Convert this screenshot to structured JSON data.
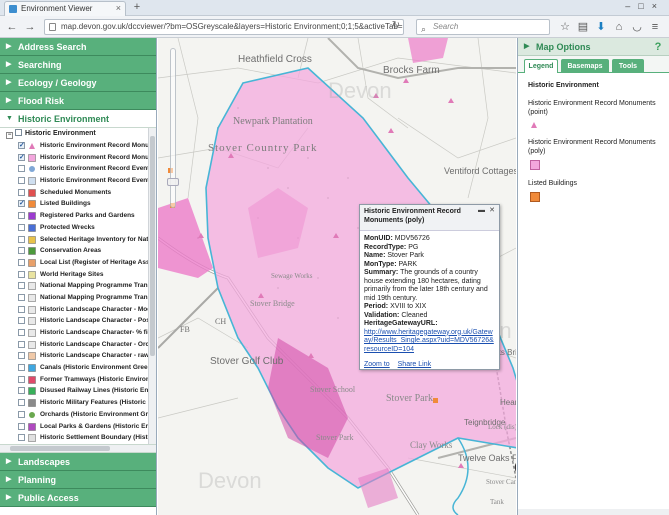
{
  "browser": {
    "tab_title": "Environment Viewer",
    "url": "map.devon.gov.uk/dccviewer/?bm=OSGreyscale&layers=Historic Environment;0;1;5&activeTab=Historic Environment&extent=...",
    "search_placeholder": "Search"
  },
  "left_panel": {
    "sections_top": [
      {
        "label": "Address Search"
      },
      {
        "label": "Searching"
      },
      {
        "label": "Ecology / Geology"
      },
      {
        "label": "Flood Risk"
      }
    ],
    "open_section": "Historic Environment",
    "tree_root": "Historic Environment",
    "layers": [
      {
        "label": "Historic Environment Record Monume",
        "checked": true,
        "symbol": "triangle",
        "color": "#e07ab8"
      },
      {
        "label": "Historic Environment Record Monume",
        "checked": true,
        "symbol": "square",
        "color": "#f3a6dd"
      },
      {
        "label": "Historic Environment Record Events (p",
        "checked": false,
        "symbol": "circle",
        "color": "#7fa7d6"
      },
      {
        "label": "Historic Environment Record Events (p",
        "checked": false,
        "symbol": "square",
        "color": "#cfdff0"
      },
      {
        "label": "Scheduled Monuments",
        "checked": false,
        "symbol": "square",
        "color": "#e05050"
      },
      {
        "label": "Listed Buildings",
        "checked": true,
        "symbol": "square",
        "color": "#f08a3a"
      },
      {
        "label": "Registered Parks and Gardens",
        "checked": false,
        "symbol": "square",
        "color": "#9c3bd0"
      },
      {
        "label": "Protected Wrecks",
        "checked": false,
        "symbol": "square",
        "color": "#4a6fd6"
      },
      {
        "label": "Selected Heritage Inventory for Natura",
        "checked": false,
        "symbol": "square",
        "color": "#e8c24a"
      },
      {
        "label": "Conservation Areas",
        "checked": false,
        "symbol": "square",
        "color": "#4c9a3c"
      },
      {
        "label": "Local List (Register of Heritage Assets",
        "checked": false,
        "symbol": "square",
        "color": "#e8a06a"
      },
      {
        "label": "World Heritage Sites",
        "checked": false,
        "symbol": "square",
        "color": "#e9e3a0"
      },
      {
        "label": "National Mapping Programme Transcrip",
        "checked": false,
        "symbol": "square",
        "color": "#e9e9e9"
      },
      {
        "label": "National Mapping Programme Transcrip",
        "checked": false,
        "symbol": "square",
        "color": "#e9e9e9"
      },
      {
        "label": "Historic Landscape Character - Modern",
        "checked": false,
        "symbol": "square",
        "color": "#e9e9e9"
      },
      {
        "label": "Historic Landscape Character - Postme",
        "checked": false,
        "symbol": "square",
        "color": "#e9e9e9"
      },
      {
        "label": "Historic Landscape Character- % field b",
        "checked": false,
        "symbol": "square",
        "color": "#e9e9e9"
      },
      {
        "label": "Historic Landscape Character - Orcharc",
        "checked": false,
        "symbol": "square",
        "color": "#e9e9e9"
      },
      {
        "label": "Historic Landscape Character - raw da",
        "checked": false,
        "symbol": "square",
        "color": "#f0c9a8"
      },
      {
        "label": "Canals (Historic Environment Green In",
        "checked": false,
        "symbol": "square",
        "color": "#3fa7e0"
      },
      {
        "label": "Former Tramways (Historic Environme",
        "checked": false,
        "symbol": "square",
        "color": "#e04a6a"
      },
      {
        "label": "Disused Railway Lines (Historic Enviro",
        "checked": false,
        "symbol": "square",
        "color": "#38b05a"
      },
      {
        "label": "Historic Military Features (Historic Env",
        "checked": false,
        "symbol": "square",
        "color": "#8a8a8a"
      },
      {
        "label": "Orchards (Historic Environment Green",
        "checked": false,
        "symbol": "circle",
        "color": "#6aa84f"
      },
      {
        "label": "Local Parks & Gardens (Historic Enviro",
        "checked": false,
        "symbol": "square",
        "color": "#b04ac0"
      },
      {
        "label": "Historic Settlement Boundary (Historic",
        "checked": false,
        "symbol": "square",
        "color": "#e0e0e0"
      }
    ],
    "sections_bottom": [
      {
        "label": "Landscapes"
      },
      {
        "label": "Planning"
      },
      {
        "label": "Public Access"
      }
    ]
  },
  "map": {
    "place_labels": [
      "Heathfield Cross",
      "Brocks Farm",
      "Newpark Plantation",
      "Stover Country Park",
      "Ventiford Cottages",
      "Sewage Works",
      "Stover Bridge",
      "FB",
      "CH",
      "Stover Golf Club",
      "Stover School",
      "Stover Park",
      "Clay Works",
      "Teignbridge",
      "Hearders",
      "Locks Bridge",
      "Twelve Oaks Farm",
      "Stover Canal (dis)",
      "Stover Park",
      "Lock (dis)",
      "Tank"
    ],
    "watermark": "Devon"
  },
  "popup": {
    "title": "Historic Environment Record Monuments (poly)",
    "fields": [
      {
        "key": "MonUID:",
        "value": "MDV56726"
      },
      {
        "key": "RecordType:",
        "value": "PG"
      },
      {
        "key": "Name:",
        "value": "Stover Park"
      },
      {
        "key": "MonType:",
        "value": "PARK"
      },
      {
        "key": "Summary:",
        "value": "The grounds of a country house extending 180 hectares, dating primarily from the later 18th century and mid 19th century."
      },
      {
        "key": "Period:",
        "value": "XVIII to XIX"
      },
      {
        "key": "Validation:",
        "value": "Cleaned"
      }
    ],
    "url_key": "HeritageGatewayURL:",
    "url": "http://www.heritagegateway.org.uk/Gateway/Results_Single.aspx?uid=MDV56726&resourceID=104",
    "zoom_link": "Zoom to",
    "share_link": "Share Link"
  },
  "right_panel": {
    "title": "Map Options",
    "tabs": [
      "Legend",
      "Basemaps",
      "Tools"
    ],
    "active_tab": "Legend",
    "legend_heading": "Historic Environment",
    "legend_items": [
      {
        "label": "Historic Environment Record Monuments (point)",
        "symbol": "triangle",
        "color": "#e07ab8"
      },
      {
        "label": "Historic Environment Record Monuments (poly)",
        "symbol": "square",
        "color": "#f3a6dd"
      },
      {
        "label": "Listed Buildings",
        "symbol": "square",
        "color": "#f08a3a"
      }
    ]
  }
}
